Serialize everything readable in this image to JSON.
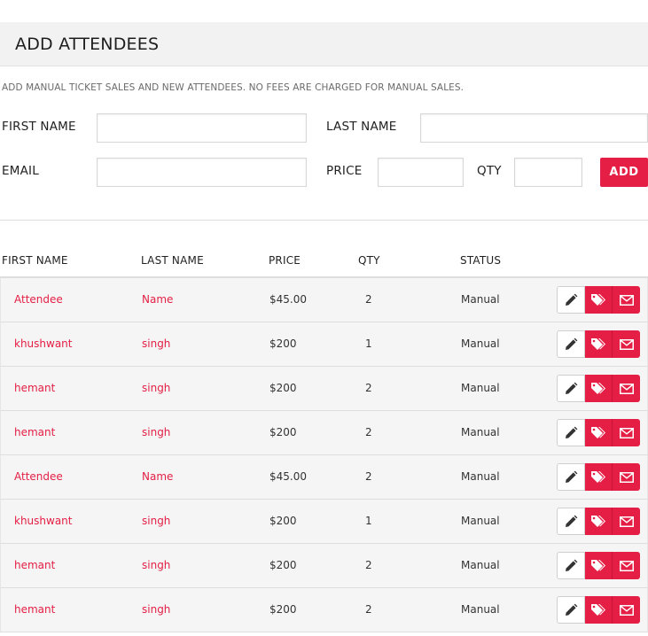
{
  "header": {
    "title": "ADD ATTENDEES",
    "subtitle": "ADD MANUAL TICKET SALES AND NEW ATTENDEES. NO FEES ARE CHARGED FOR MANUAL SALES."
  },
  "form": {
    "first_name_label": "FIRST NAME",
    "last_name_label": "LAST NAME",
    "email_label": "EMAIL",
    "price_label": "PRICE",
    "qty_label": "QTY",
    "first_name_value": "",
    "last_name_value": "",
    "email_value": "",
    "price_value": "",
    "qty_value": "",
    "add_label": "ADD"
  },
  "table": {
    "columns": [
      "FIRST NAME",
      "LAST NAME",
      "PRICE",
      "QTY",
      "STATUS"
    ],
    "rows": [
      {
        "first": "Attendee",
        "last": "Name",
        "price": "$45.00",
        "qty": "2",
        "status": "Manual"
      },
      {
        "first": "khushwant",
        "last": "singh",
        "price": "$200",
        "qty": "1",
        "status": "Manual"
      },
      {
        "first": "hemant",
        "last": "singh",
        "price": "$200",
        "qty": "2",
        "status": "Manual"
      },
      {
        "first": "hemant",
        "last": "singh",
        "price": "$200",
        "qty": "2",
        "status": "Manual"
      },
      {
        "first": "Attendee",
        "last": "Name",
        "price": "$45.00",
        "qty": "2",
        "status": "Manual"
      },
      {
        "first": "khushwant",
        "last": "singh",
        "price": "$200",
        "qty": "1",
        "status": "Manual"
      },
      {
        "first": "hemant",
        "last": "singh",
        "price": "$200",
        "qty": "2",
        "status": "Manual"
      },
      {
        "first": "hemant",
        "last": "singh",
        "price": "$200",
        "qty": "2",
        "status": "Manual"
      }
    ],
    "row_actions": [
      "pencil-icon",
      "tag-icon",
      "envelope-icon"
    ]
  },
  "colors": {
    "accent": "#e41e44",
    "header_bg": "#f2f2f2",
    "row_bg": "#f5f5f5"
  }
}
